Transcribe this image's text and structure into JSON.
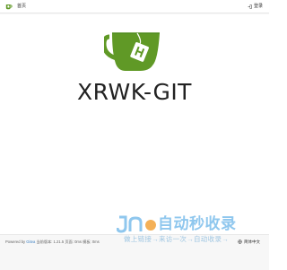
{
  "navbar": {
    "home_label": "首页",
    "login_label": "登录"
  },
  "hero": {
    "title": "XRWK-GIT"
  },
  "watermark": {
    "title": "自动秒收录",
    "subtitle": "做上链接→来访一次→自动收录→"
  },
  "footer": {
    "powered_prefix": "Powered by",
    "powered_link": "Gitea",
    "version_text": "当前版本: 1.21.5 页面: 0ms 模板: 0ms",
    "language_label": "简体中文"
  },
  "colors": {
    "brand_green": "#609926",
    "watermark_blue": "#8fc7ee",
    "link_blue": "#4183c4"
  },
  "icons": {
    "nav_logo": "gitea-logo-icon",
    "login": "sign-in-icon",
    "language": "globe-icon",
    "hero_logo": "gitea-teacup-logo-icon"
  }
}
